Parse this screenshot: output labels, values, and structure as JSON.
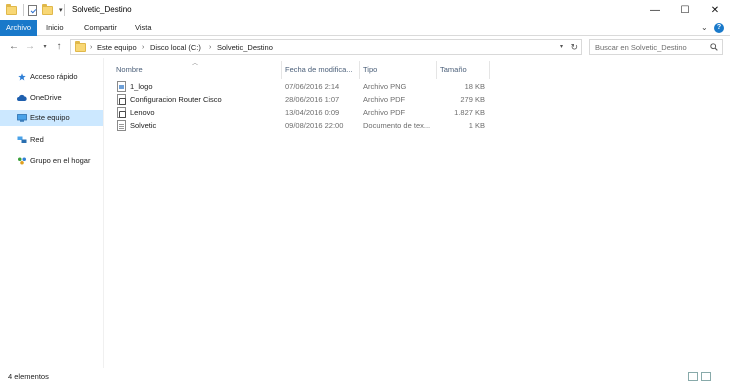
{
  "window": {
    "title": "Solvetic_Destino",
    "controls": {
      "minimize": "—",
      "maximize": "☐",
      "close": "✕"
    }
  },
  "ribbon": {
    "tabs": [
      "Archivo",
      "Inicio",
      "Compartir",
      "Vista"
    ],
    "expand_icon": "chevron-down-icon",
    "accent_color": "#1979ca"
  },
  "address": {
    "breadcrumbs": [
      "Este equipo",
      "Disco local (C:)",
      "Solvetic_Destino"
    ]
  },
  "search": {
    "placeholder": "Buscar en Solvetic_Destino"
  },
  "navpane": {
    "items": [
      {
        "label": "Acceso rápido",
        "icon": "star-icon",
        "selected": false
      },
      {
        "label": "OneDrive",
        "icon": "cloud-icon",
        "selected": false
      },
      {
        "label": "Este equipo",
        "icon": "computer-icon",
        "selected": true
      },
      {
        "label": "Red",
        "icon": "network-icon",
        "selected": false
      },
      {
        "label": "Grupo en el hogar",
        "icon": "homegroup-icon",
        "selected": false
      }
    ]
  },
  "columns": {
    "name": "Nombre",
    "date": "Fecha de modifica...",
    "type": "Tipo",
    "size": "Tamaño"
  },
  "files": [
    {
      "name": "1_logo",
      "date": "07/06/2016 2:14",
      "type": "Archivo PNG",
      "size": "18 KB",
      "icon": "png-file-icon"
    },
    {
      "name": "Configuracion Router Cisco",
      "date": "28/06/2016 1:07",
      "type": "Archivo PDF",
      "size": "279 KB",
      "icon": "pdf-file-icon"
    },
    {
      "name": "Lenovo",
      "date": "13/04/2016 0:09",
      "type": "Archivo PDF",
      "size": "1.827 KB",
      "icon": "pdf-file-icon"
    },
    {
      "name": "Solvetic",
      "date": "09/08/2016 22:00",
      "type": "Documento de tex...",
      "size": "1 KB",
      "icon": "text-file-icon"
    }
  ],
  "status": {
    "item_count": "4 elementos"
  }
}
